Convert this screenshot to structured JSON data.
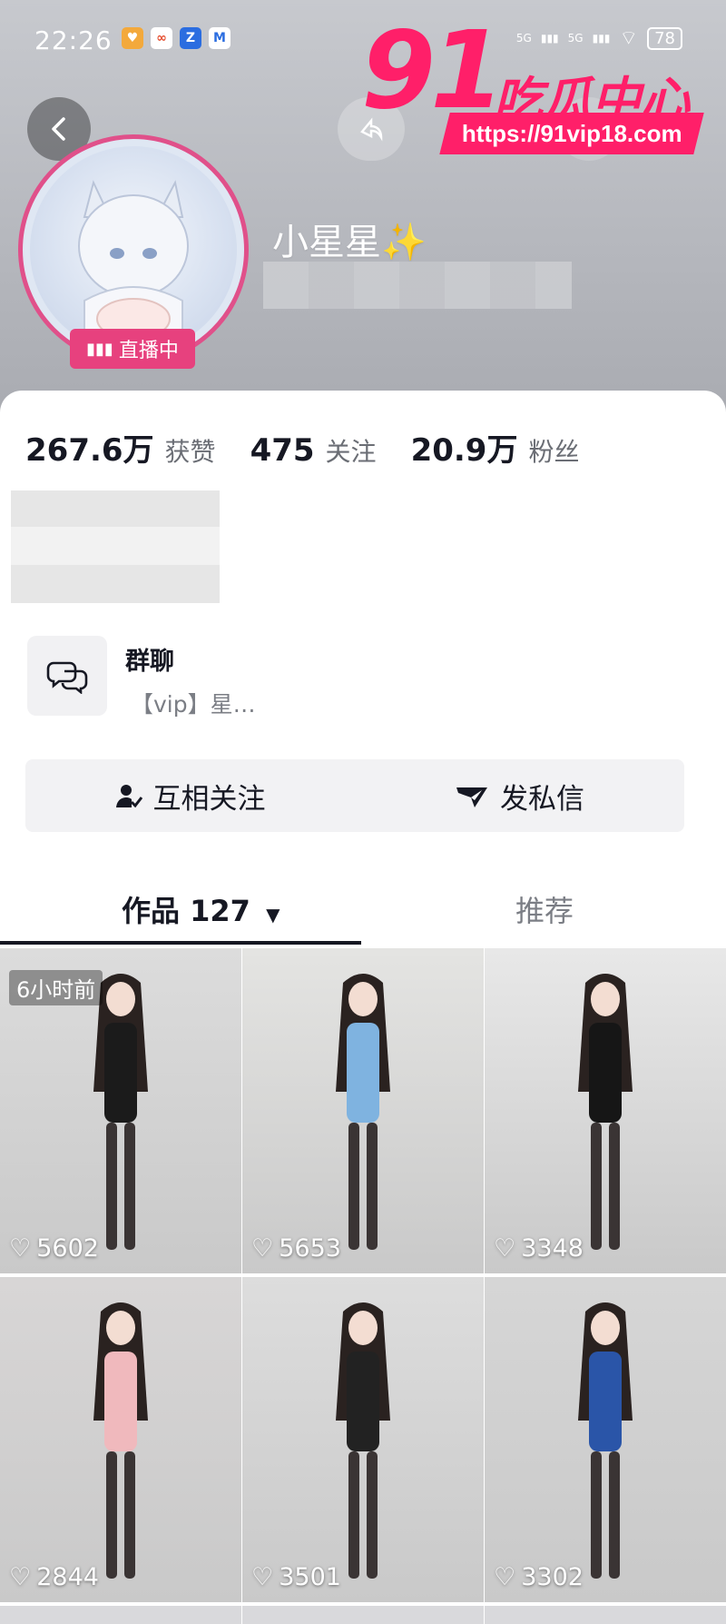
{
  "status_bar": {
    "time": "22:26",
    "battery": "78",
    "net1": "5G",
    "net2": "5G"
  },
  "watermark": {
    "number": "91",
    "text": "吃瓜中心",
    "url": "https://91vip18.com"
  },
  "profile": {
    "nickname": "小星星✨",
    "live_badge": "直播中"
  },
  "stats": [
    {
      "value": "267.6万",
      "label": "获赞"
    },
    {
      "value": "475",
      "label": "关注"
    },
    {
      "value": "20.9万",
      "label": "粉丝"
    }
  ],
  "group": {
    "title": "群聊",
    "subtitle": "【vip】星…"
  },
  "actions": {
    "follow": "互相关注",
    "message": "发私信"
  },
  "tabs": {
    "works": "作品 127",
    "recommend": "推荐"
  },
  "videos": [
    {
      "likes": "5602",
      "time_tag": "6小时前",
      "bg": "#dcdcdc",
      "outfit": "#1b1b1b"
    },
    {
      "likes": "5653",
      "bg": "#e4e4e2",
      "outfit": "#7fb3e0"
    },
    {
      "likes": "3348",
      "bg": "#e8e8e8",
      "outfit": "#161616"
    },
    {
      "likes": "2844",
      "bg": "#d8d6d6",
      "outfit": "#f0b9bd"
    },
    {
      "likes": "3501",
      "bg": "#dddddd",
      "outfit": "#222222"
    },
    {
      "likes": "3302",
      "bg": "#d6d6d6",
      "outfit": "#2a55a8"
    }
  ]
}
